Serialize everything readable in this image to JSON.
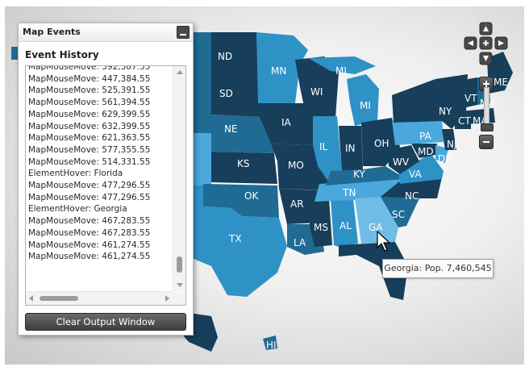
{
  "panel": {
    "title": "Map Events",
    "history_title": "Event History",
    "clear_label": "Clear Output Window"
  },
  "log": [
    "MapMouseMove: 392,387.55",
    "MapMouseMove: 447,384.55",
    "MapMouseMove: 525,391.55",
    "MapMouseMove: 561,394.55",
    "MapMouseMove: 629,399.55",
    "MapMouseMove: 632,399.55",
    "MapMouseMove: 621,363.55",
    "MapMouseMove: 577,355.55",
    "MapMouseMove: 514,331.55",
    "ElementHover: Florida",
    "MapMouseMove: 477,296.55",
    "MapMouseMove: 477,296.55",
    "ElementHover: Georgia",
    "MapMouseMove: 467,283.55",
    "MapMouseMove: 467,283.55",
    "MapMouseMove: 461,274.55",
    "MapMouseMove: 461,274.55"
  ],
  "tooltip": "Georgia: Pop. 7,460,545",
  "map": {
    "colors": {
      "dark": "#173e5a",
      "mid": "#1f6b94",
      "light": "#2f92c6",
      "pale": "#4aa8dc",
      "highlight": "#6fbde6"
    },
    "state_labels": [
      "ND",
      "MN",
      "MI",
      "SD",
      "WI",
      "MI",
      "NY",
      "VT",
      "NH",
      "ME",
      "NE",
      "IA",
      "PA",
      "CT",
      "MA",
      "IL",
      "IN",
      "OH",
      "MD",
      "NJ",
      "DE",
      "KS",
      "MO",
      "KY",
      "WV",
      "VA",
      "TN",
      "OK",
      "AR",
      "NC",
      "SC",
      "MS",
      "AL",
      "GA",
      "TX",
      "LA",
      "HI"
    ],
    "nav_icons": [
      "pan-up-icon",
      "pan-left-icon",
      "pan-center-icon",
      "pan-right-icon",
      "pan-down-icon"
    ],
    "zoom_icons": [
      "zoom-in-icon",
      "zoom-out-icon"
    ]
  }
}
